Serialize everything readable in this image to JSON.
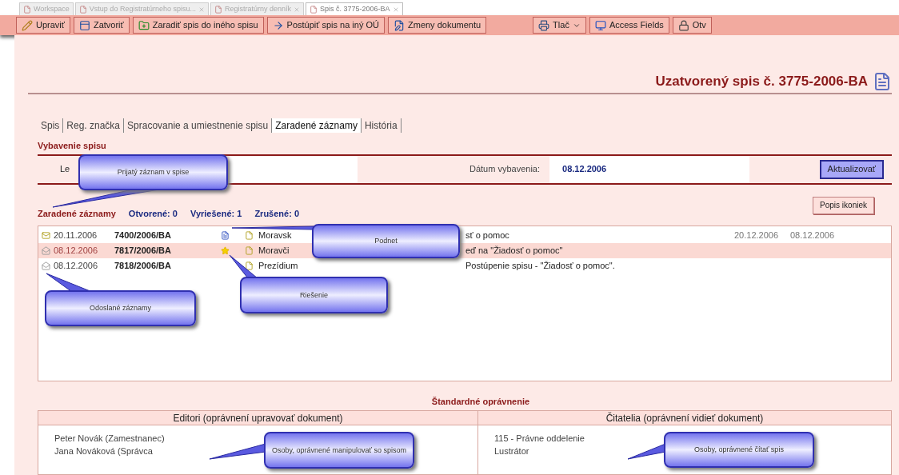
{
  "browser_tabs": [
    {
      "label": "Workspace",
      "selected": false,
      "closable": false
    },
    {
      "label": "Vstup do Registratúrneho spisu...",
      "selected": false,
      "closable": true
    },
    {
      "label": "Registratúrny denník",
      "selected": false,
      "closable": true
    },
    {
      "label": "Spis č. 3775-2006-BA",
      "selected": true,
      "closable": true
    }
  ],
  "toolbar": {
    "left": [
      {
        "label": "Upraviť",
        "dropdown": false
      },
      {
        "label": "Zatvoriť",
        "dropdown": false
      },
      {
        "label": "Zaradiť spis do iného spisu",
        "dropdown": false
      },
      {
        "label": "Postúpiť spis na iný OÚ",
        "dropdown": false
      },
      {
        "label": "Zmeny dokumentu",
        "dropdown": false
      }
    ],
    "right": [
      {
        "label": "Tlač",
        "dropdown": true
      },
      {
        "label": "Access Fields",
        "dropdown": false
      },
      {
        "label": "Otv",
        "dropdown": false
      }
    ]
  },
  "title": "Uzatvorený spis č. 3775-2006-**BA**",
  "tabs": [
    {
      "label": "Spis",
      "selected": false
    },
    {
      "label": "Reg. značka",
      "selected": false
    },
    {
      "label": "Spracovanie a umiestnenie spisu",
      "selected": false
    },
    {
      "label": "Zaradené záznamy",
      "selected": true
    },
    {
      "label": "História",
      "selected": false
    }
  ],
  "closing": {
    "heading": "Vybavenie spisu",
    "field_label": "Le",
    "date_label": "Dátum vybavenia:",
    "date_value": "08.12.2006",
    "button": "Aktualizovať"
  },
  "icon_legend_button": "Popis ikoniek",
  "records": {
    "heading": "Zaradené záznamy",
    "counts": [
      "Otvorené: 0",
      "Vyriešené: 1",
      "Zrušené: 0"
    ],
    "rows": [
      {
        "kind": "received",
        "date": "20.11.2006",
        "number": "7400/2006/BA",
        "name": "Moravsk",
        "subject": "sť o pomoc",
        "due": "20.12.2006",
        "resolved": "08.12.2006",
        "selected": false
      },
      {
        "kind": "sent",
        "date": "08.12.2006",
        "number": "7817/2006/BA",
        "name": "Moravči",
        "subject": "eď na \"Žiadosť o pomoc\"",
        "selected": true
      },
      {
        "kind": "sent",
        "date": "08.12.2006",
        "number": "7818/2006/BA",
        "name": "Prezídium",
        "subject": "Postúpenie spisu - \"Žiadosť o pomoc\".",
        "selected": false
      }
    ]
  },
  "permissions": {
    "heading": "Štandardné oprávnenie",
    "editors_header": "Editori (oprávnení upravovať dokument)",
    "readers_header": "Čitatelia (oprávnení vidieť dokument)",
    "editors": [
      "Peter Novák (Zamestnanec)",
      "Jana Nováková (Správca"
    ],
    "readers": [
      "115 - Právne oddelenie",
      "Lustrátor"
    ]
  },
  "callouts": [
    {
      "text": "Prijatý záznam v spise"
    },
    {
      "text": "Podnet"
    },
    {
      "text": "Riešenie"
    },
    {
      "text": "Odoslané záznamy"
    },
    {
      "text": "Osoby, oprávnené manipulovať so spisom"
    },
    {
      "text": "Osoby, oprávnené čítať spis"
    }
  ]
}
